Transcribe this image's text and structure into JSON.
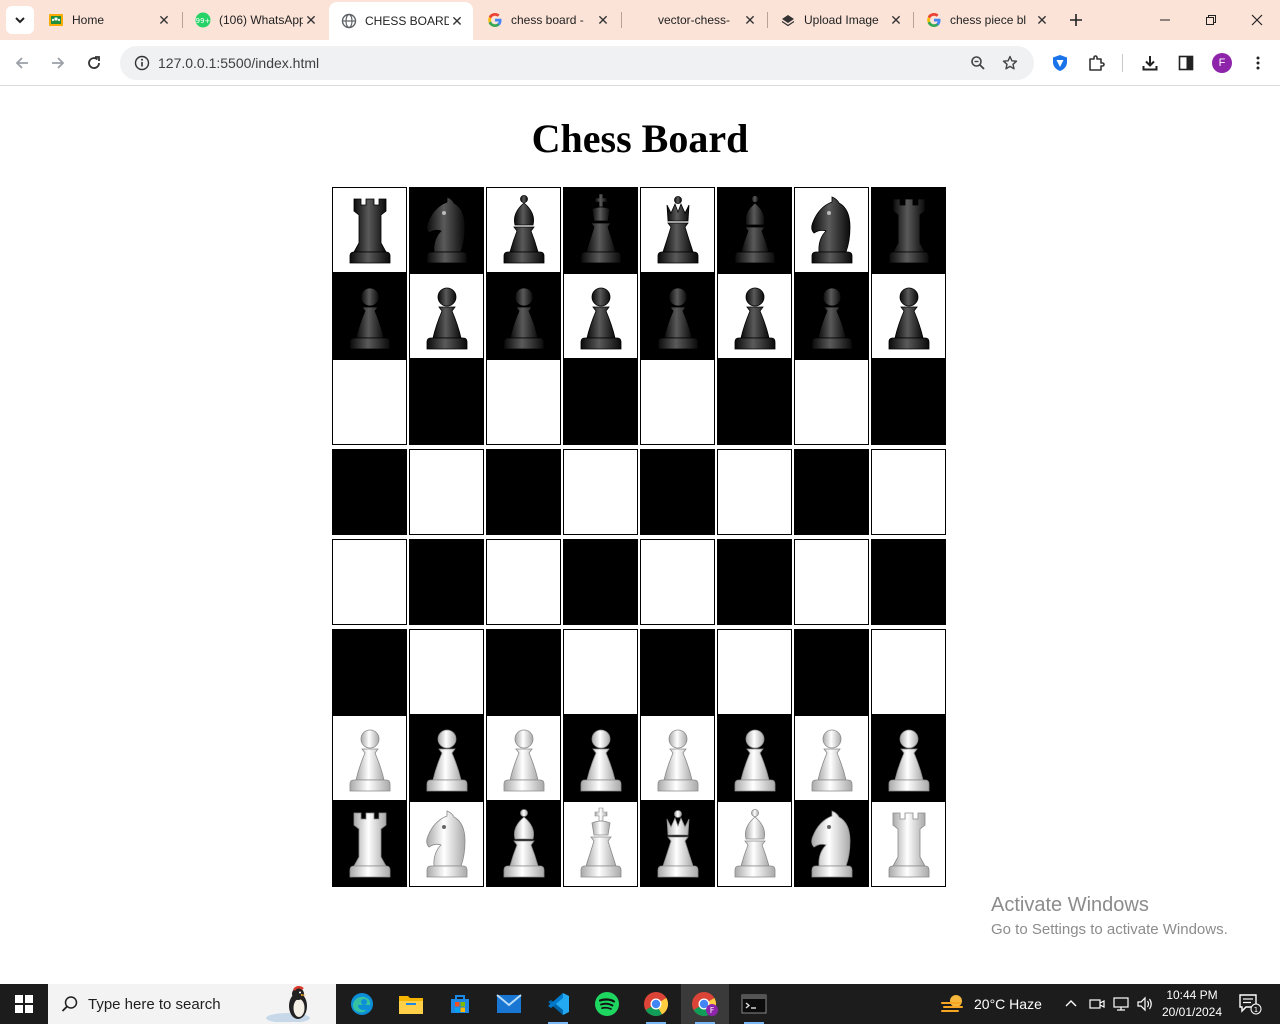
{
  "browser": {
    "tabs": [
      {
        "title": "Home",
        "icon": "google-classroom-icon"
      },
      {
        "title": "(106) WhatsApp",
        "icon": "whatsapp-icon",
        "badge": "99+"
      },
      {
        "title": "CHESS BOARD",
        "icon": "globe-icon",
        "active": true
      },
      {
        "title": "chess board -",
        "icon": "google-icon"
      },
      {
        "title": "vector-chess-",
        "icon": "blank-page-icon"
      },
      {
        "title": "Upload Image",
        "icon": "imgbb-icon"
      },
      {
        "title": "chess piece bl",
        "icon": "google-icon"
      }
    ],
    "close_glyph": "✕",
    "address": "127.0.0.1:5500/index.html",
    "profile_initial": "F"
  },
  "page": {
    "title": "Chess Board",
    "board": {
      "rows": [
        [
          "black-rook",
          "black-knight",
          "black-bishop",
          "black-king",
          "black-queen",
          "black-bishop",
          "black-knight",
          "black-rook"
        ],
        [
          "black-pawn",
          "black-pawn",
          "black-pawn",
          "black-pawn",
          "black-pawn",
          "black-pawn",
          "black-pawn",
          "black-pawn"
        ],
        [
          "",
          "",
          "",
          "",
          "",
          "",
          "",
          ""
        ],
        [
          "",
          "",
          "",
          "",
          "",
          "",
          "",
          ""
        ],
        [
          "",
          "",
          "",
          "",
          "",
          "",
          "",
          ""
        ],
        [
          "",
          "",
          "",
          "",
          "",
          "",
          "",
          ""
        ],
        [
          "white-pawn",
          "white-pawn",
          "white-pawn",
          "white-pawn",
          "white-pawn",
          "white-pawn",
          "white-pawn",
          "white-pawn"
        ],
        [
          "white-rook",
          "white-knight",
          "white-bishop",
          "white-king",
          "white-queen",
          "white-bishop",
          "white-knight",
          "white-rook"
        ]
      ],
      "colors": {
        "light": "#ffffff",
        "dark": "#000000"
      }
    },
    "watermark": {
      "line1": "Activate Windows",
      "line2": "Go to Settings to activate Windows."
    }
  },
  "taskbar": {
    "search_placeholder": "Type here to search",
    "weather": "20°C  Haze",
    "time": "10:44 PM",
    "date": "20/01/2024",
    "notification_count": "1"
  }
}
